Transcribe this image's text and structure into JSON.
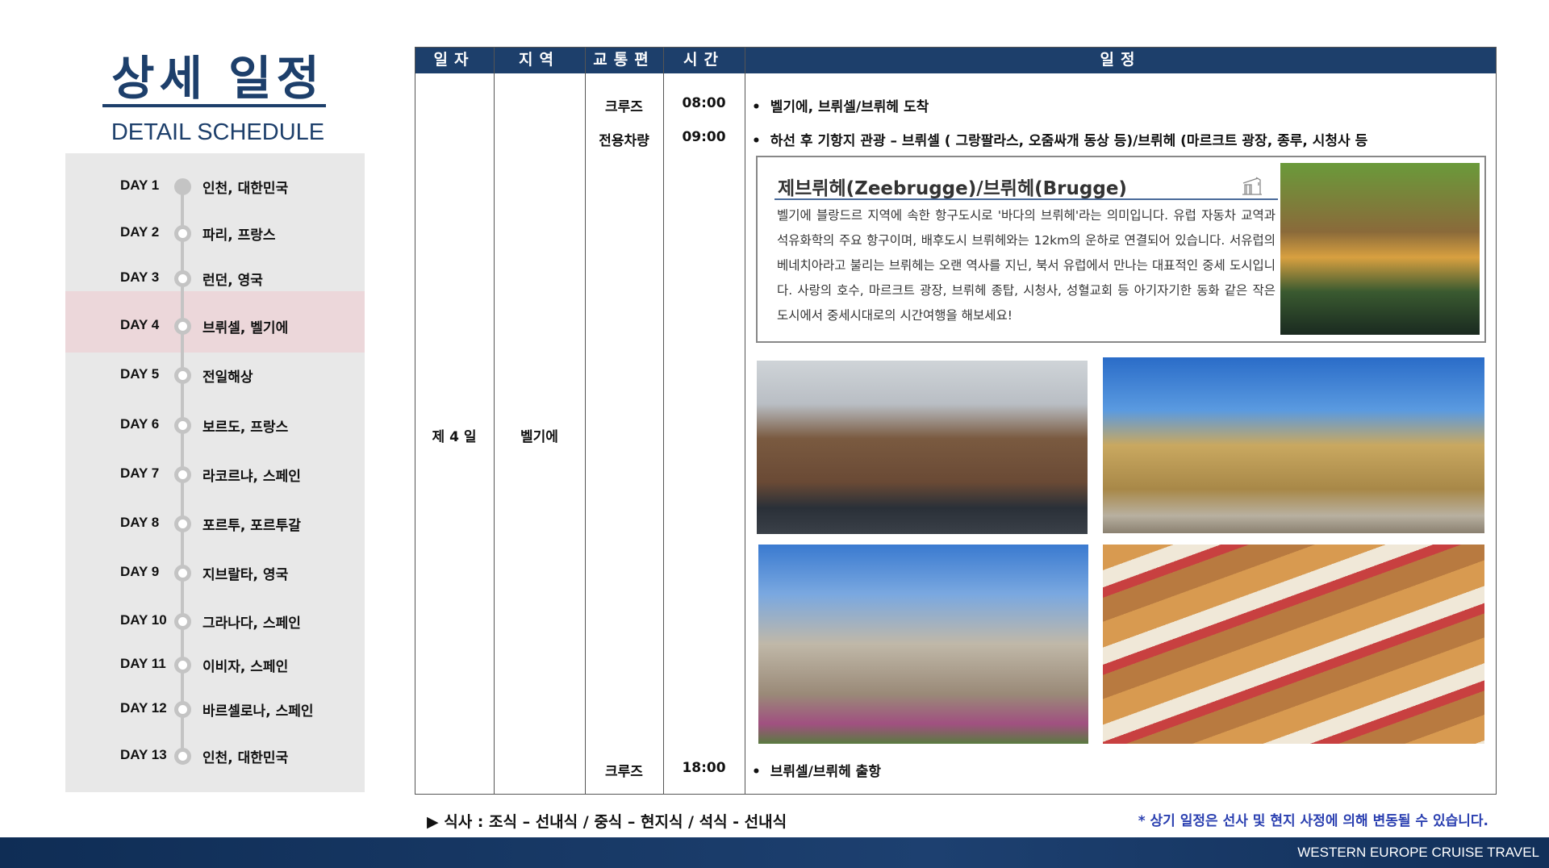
{
  "header": {
    "title": "상세 일정",
    "subtitle": "DETAIL SCHEDULE"
  },
  "sidebar": {
    "active_index": 3,
    "days": [
      {
        "day": "DAY 1",
        "place": "인천, 대한민국"
      },
      {
        "day": "DAY 2",
        "place": "파리, 프랑스"
      },
      {
        "day": "DAY 3",
        "place": "런던, 영국"
      },
      {
        "day": "DAY 4",
        "place": "브뤼셀, 벨기에"
      },
      {
        "day": "DAY 5",
        "place": "전일해상"
      },
      {
        "day": "DAY 6",
        "place": "보르도, 프랑스"
      },
      {
        "day": "DAY 7",
        "place": "라코르냐, 스페인"
      },
      {
        "day": "DAY 8",
        "place": "포르투, 포르투갈"
      },
      {
        "day": "DAY 9",
        "place": "지브랄타, 영국"
      },
      {
        "day": "DAY 10",
        "place": "그라나다, 스페인"
      },
      {
        "day": "DAY 11",
        "place": "이비자, 스페인"
      },
      {
        "day": "DAY 12",
        "place": "바르셀로나, 스페인"
      },
      {
        "day": "DAY 13",
        "place": "인천, 대한민국"
      }
    ]
  },
  "table": {
    "headers": [
      "일자",
      "지역",
      "교통편",
      "시간",
      "일정"
    ],
    "day": "제 4 일",
    "region": "벨기에",
    "rows": [
      {
        "transport": "크루즈",
        "time": "08:00",
        "schedule": "벨기에, 브뤼셀/브뤼헤 도착"
      },
      {
        "transport": "전용차량",
        "time": "09:00",
        "schedule": "하선 후 기항지 관광 – 브뤼셀 ( 그랑팔라스, 오줌싸개 동상 등)/브뤼헤 (마르크트 광장, 종루, 시청사 등"
      },
      {
        "transport": "크루즈",
        "time": "18:00",
        "schedule": "브뤼셀/브뤼헤 출항"
      }
    ],
    "bullet": "•"
  },
  "info": {
    "title": "제브뤼헤(Zeebrugge)/브뤼헤(Brugge)",
    "body": "벨기에 블랑드르 지역에 속한 항구도시로 '바다의 브뤼헤'라는 의미입니다. 유럽 자동차 교역과 석유화학의 주요 항구이며, 배후도시 브뤼헤와는 12km의 운하로 연결되어 있습니다. 서유럽의 베네치아라고 불리는 브뤼헤는 오랜 역사를 지닌, 북서 유럽에서 만나는 대표적인 중세 도시입니다. 사랑의 호수, 마르크트 광장, 브뤼헤 종탑, 시청사, 성혈교회 등 아기자기한 동화 같은 작은 도시에서 중세시대로의 시간여행을 해보세요!"
  },
  "footer": {
    "meal": "▶ 식사 : 조식 – 선내식 / 중식 – 현지식 / 석식 - 선내식",
    "note": "* 상기 일정은 선사 및 현지 사정에 의해 변동될 수 있습니다.",
    "brand": "WESTERN EUROPE CRUISE TRAVEL"
  },
  "colors": {
    "navy": "#1d3f6b",
    "highlight": "#ecd7da",
    "panel": "#e8e8e8",
    "note": "#2a3fb0"
  }
}
